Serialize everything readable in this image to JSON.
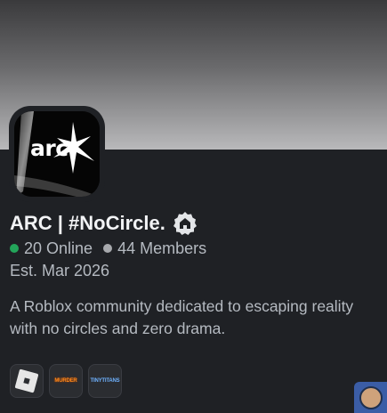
{
  "server": {
    "icon_text": "arc",
    "name": "ARC | #NoCircle.",
    "online_text": "20 Online",
    "members_text": "44 Members",
    "established": "Est. Mar 2026",
    "description": "A Roblox community dedicated to escaping reality with no circles and zero drama."
  },
  "games": [
    {
      "name": "Roblox",
      "icon": "roblox-icon"
    },
    {
      "name": "Murder Mystery",
      "icon": "murder-mystery-icon",
      "label": "MURDER"
    },
    {
      "name": "Tiny Titans",
      "icon": "tiny-titans-icon",
      "label": "TINYTITANS"
    }
  ],
  "badge_icon": "community-badge-icon",
  "colors": {
    "background": "#1f2125",
    "online": "#23a55a",
    "members": "#a7a9ad",
    "text_primary": "#f2f3f5",
    "text_secondary": "#b5bac1"
  }
}
